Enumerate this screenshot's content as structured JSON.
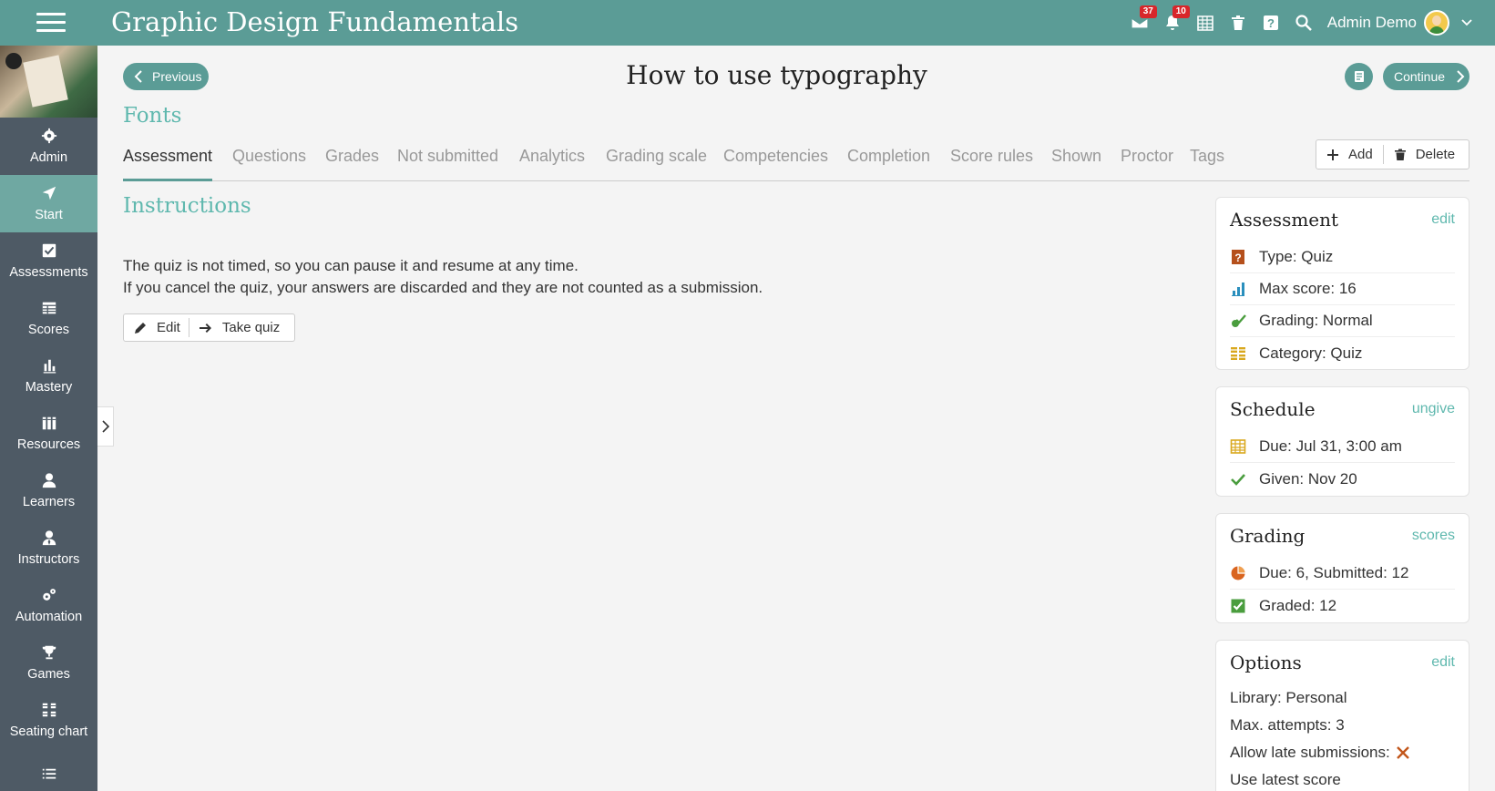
{
  "app": {
    "title": "Graphic Design Fundamentals",
    "user_name": "Admin Demo",
    "badges": {
      "messages": "37",
      "notifications": "10"
    },
    "accent_color": "#5b9c96"
  },
  "sidebar": {
    "items": [
      {
        "label": "Admin",
        "icon": "gear-icon"
      },
      {
        "label": "Start",
        "icon": "paper-plane-icon",
        "active": true
      },
      {
        "label": "Assessments",
        "icon": "checkbox-icon"
      },
      {
        "label": "Scores",
        "icon": "table-icon"
      },
      {
        "label": "Mastery",
        "icon": "bar-chart-icon"
      },
      {
        "label": "Resources",
        "icon": "books-icon"
      },
      {
        "label": "Learners",
        "icon": "person-icon"
      },
      {
        "label": "Instructors",
        "icon": "instructor-icon"
      },
      {
        "label": "Automation",
        "icon": "gears-icon"
      },
      {
        "label": "Games",
        "icon": "trophy-icon"
      },
      {
        "label": "Seating chart",
        "icon": "seating-icon"
      },
      {
        "label": "",
        "icon": "list-icon"
      }
    ]
  },
  "nav": {
    "previous_label": "Previous",
    "continue_label": "Continue"
  },
  "page": {
    "title": "How to use typography",
    "section": "Fonts"
  },
  "tabs": [
    {
      "label": "Assessment",
      "active": true
    },
    {
      "label": "Questions"
    },
    {
      "label": "Grades"
    },
    {
      "label": "Not submitted"
    },
    {
      "label": "Analytics"
    },
    {
      "label": "Grading scale"
    },
    {
      "label": "Competencies"
    },
    {
      "label": "Completion"
    },
    {
      "label": "Score rules"
    },
    {
      "label": "Shown"
    },
    {
      "label": "Proctor"
    },
    {
      "label": "Tags"
    }
  ],
  "tab_actions": {
    "add_label": "Add",
    "delete_label": "Delete"
  },
  "instructions": {
    "title": "Instructions",
    "line1": "The quiz is not timed, so you can pause it and resume at any time.",
    "line2": "If you cancel the quiz, your answers are discarded and they are not counted as a submission.",
    "edit_label": "Edit",
    "take_quiz_label": "Take quiz"
  },
  "cards": {
    "assessment": {
      "title": "Assessment",
      "link": "edit",
      "rows": [
        "Type: Quiz",
        "Max score: 16",
        "Grading: Normal",
        "Category: Quiz"
      ]
    },
    "schedule": {
      "title": "Schedule",
      "link": "ungive",
      "rows": [
        "Due: Jul 31, 3:00 am",
        "Given: Nov 20"
      ]
    },
    "grading": {
      "title": "Grading",
      "link": "scores",
      "rows": [
        "Due: 6, Submitted: 12",
        "Graded: 12"
      ]
    },
    "options": {
      "title": "Options",
      "link": "edit",
      "rows": [
        "Library: Personal",
        "Max. attempts: 3",
        "Allow late submissions:",
        "Use latest score"
      ]
    }
  }
}
